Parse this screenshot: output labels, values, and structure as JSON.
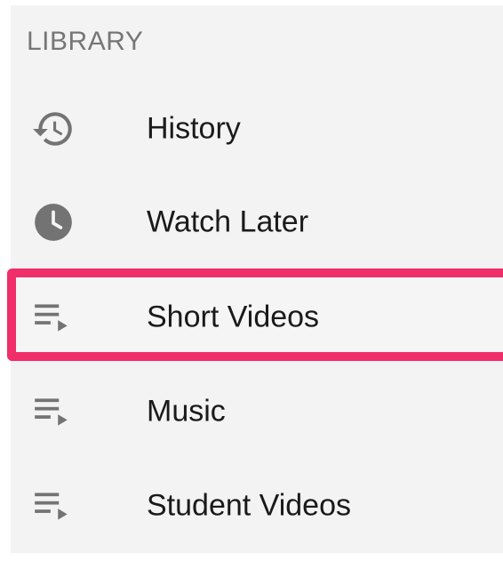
{
  "library": {
    "title": "LIBRARY",
    "items": [
      {
        "label": "History",
        "icon": "history-icon",
        "highlighted": false
      },
      {
        "label": "Watch Later",
        "icon": "clock-icon",
        "highlighted": false
      },
      {
        "label": "Short Videos",
        "icon": "playlist-icon",
        "highlighted": true
      },
      {
        "label": "Music",
        "icon": "playlist-icon",
        "highlighted": false
      },
      {
        "label": "Student Videos",
        "icon": "playlist-icon",
        "highlighted": false
      }
    ]
  },
  "colors": {
    "highlight": "#f02e6a",
    "icon": "#737373",
    "background": "#f3f3f3"
  }
}
